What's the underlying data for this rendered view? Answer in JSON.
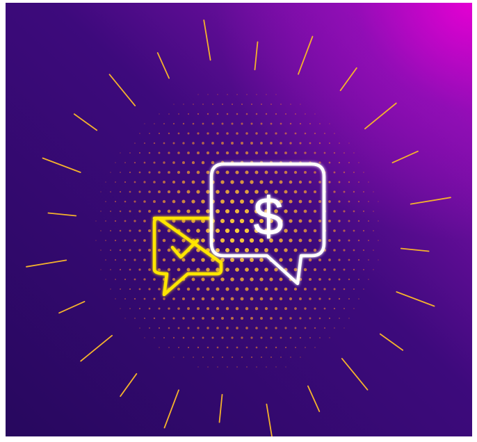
{
  "illustration": {
    "symbols": {
      "currency": "$"
    },
    "icons": {
      "main_bubble": "speech-bubble-icon",
      "secondary_bubble": "chat-bubble-icon",
      "check": "checkmark-icon",
      "currency": "dollar-sign-icon"
    },
    "colors": {
      "background_dark": "#27085e",
      "background_mid": "#5a0e97",
      "background_glow": "#e400d2",
      "main_bubble_stroke": "#ffffff",
      "secondary_bubble_stroke": "#ffe600",
      "rays": "#f5b32c",
      "dots_inner": "#ffb020",
      "dots_outer": "#ff7a2a"
    }
  }
}
